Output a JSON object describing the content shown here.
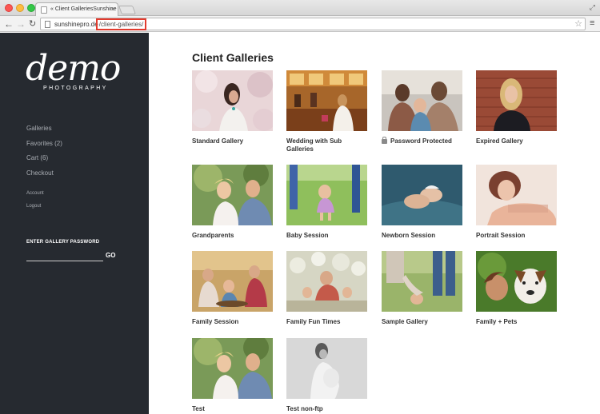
{
  "browser": {
    "tab_title": "« Client GalleriesSunshine",
    "tab_close": "×",
    "url_domain": "sunshinepro.de",
    "url_path": "/client-galleries/"
  },
  "sidebar": {
    "logo_text": "demo",
    "logo_sub": "PHOTOGRAPHY",
    "main_nav": [
      "Galleries",
      "Favorites (2)",
      "Cart (6)",
      "Checkout"
    ],
    "small_nav": [
      "Account",
      "Logout"
    ],
    "password_title": "ENTER GALLERY PASSWORD",
    "password_value": "",
    "go_label": "GO"
  },
  "main": {
    "title": "Client Galleries",
    "galleries": [
      {
        "title": "Standard Gallery",
        "locked": false
      },
      {
        "title": "Wedding with Sub Galleries",
        "locked": false
      },
      {
        "title": "Password Protected",
        "locked": true
      },
      {
        "title": "Expired Gallery",
        "locked": false
      },
      {
        "title": "Grandparents",
        "locked": false
      },
      {
        "title": "Baby Session",
        "locked": false
      },
      {
        "title": "Newborn Session",
        "locked": false
      },
      {
        "title": "Portrait Session",
        "locked": false
      },
      {
        "title": "Family Session",
        "locked": false
      },
      {
        "title": "Family Fun Times",
        "locked": false
      },
      {
        "title": "Sample Gallery",
        "locked": false
      },
      {
        "title": "Family + Pets",
        "locked": false
      },
      {
        "title": "Test",
        "locked": false
      },
      {
        "title": "Test non-ftp",
        "locked": false
      }
    ]
  },
  "colors": {
    "sidebar_bg": "#262a30",
    "url_highlight": "#e23b2e"
  }
}
